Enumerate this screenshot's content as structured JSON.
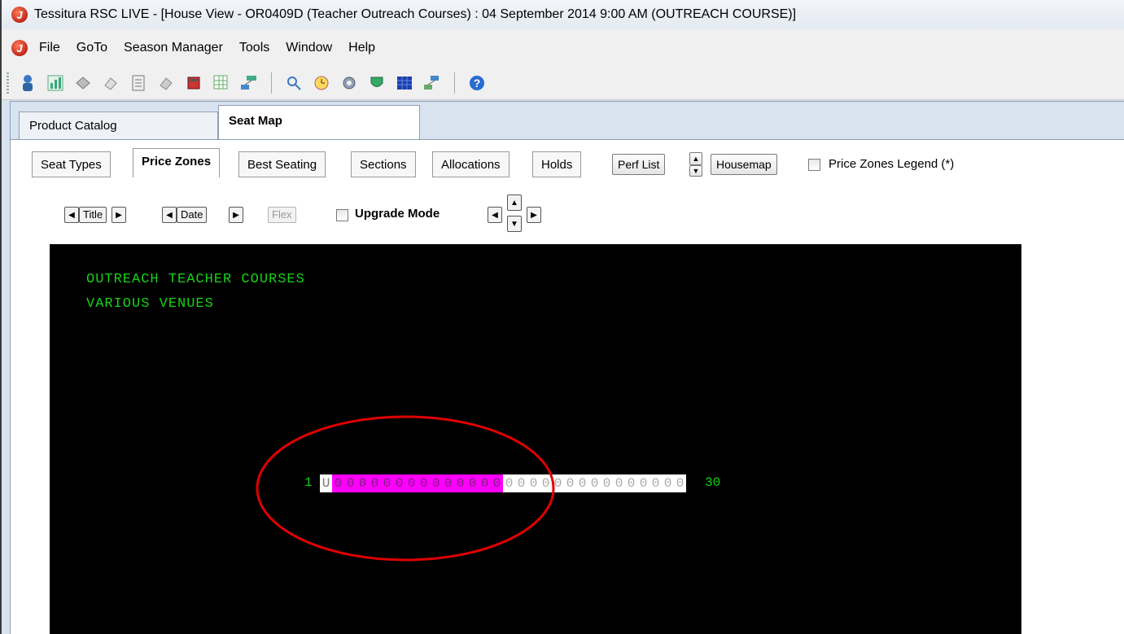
{
  "window": {
    "title": "Tessitura  RSC LIVE - [House View - OR0409D (Teacher Outreach Courses) : 04 September 2014 9:00 AM (OUTREACH COURSE)]"
  },
  "menu": [
    "File",
    "GoTo",
    "Season Manager",
    "Tools",
    "Window",
    "Help"
  ],
  "toolbar": {
    "icons": [
      "constituent-icon",
      "chart-icon",
      "tickets-icon",
      "eraser-icon",
      "document-icon",
      "eraser-2-icon",
      "book-icon",
      "grid-edit-icon",
      "org-chart-icon",
      "search-person-icon",
      "clock-icon",
      "gear-icon",
      "shield-icon",
      "calendar-grid-icon",
      "network-icon",
      "help-icon"
    ]
  },
  "top_tabs": [
    "Product Catalog",
    "Seat Map"
  ],
  "sub_tabs": [
    "Seat Types",
    "Price Zones",
    "Best Seating",
    "Sections",
    "Allocations",
    "Holds"
  ],
  "controls": {
    "perf_list": "Perf List",
    "housemap": "Housemap",
    "legend_label": "Price Zones Legend  (*)",
    "title_btn": "Title",
    "date_btn": "Date",
    "flex_btn": "Flex",
    "upgrade_label": "Upgrade Mode"
  },
  "seatmap": {
    "line1": "OUTREACH TEACHER COURSES",
    "line2": "VARIOUS VENUES",
    "row_start": "1",
    "row_end": "30",
    "seats": "U00000000000000000000000000000",
    "highlight_count": 14,
    "highlight_color": "#ff00ff",
    "annotation_color": "#e00000"
  }
}
